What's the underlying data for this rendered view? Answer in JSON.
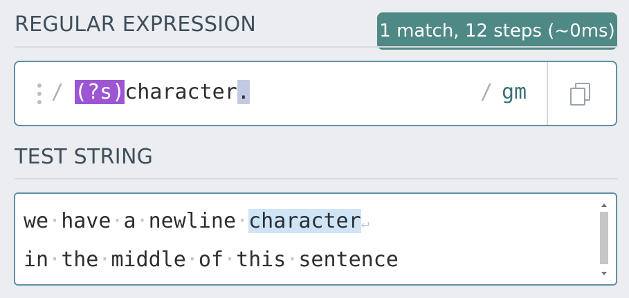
{
  "regex_section": {
    "title": "REGULAR EXPRESSION",
    "match_info": "1 match, 12 steps (~0ms)",
    "delimiter_open": "/",
    "delimiter_close": "/",
    "flags": "gm",
    "expression_tokens": [
      {
        "text": "(?s)",
        "kind": "inline-modifier-group"
      },
      {
        "text": "character",
        "kind": "literal"
      },
      {
        "text": ".",
        "kind": "any-char"
      }
    ],
    "copy_icon": "copy-icon",
    "drag_icon": "drag-handle-icon"
  },
  "test_section": {
    "title": "TEST STRING",
    "line1_words": [
      "we",
      "have",
      "a",
      "newline"
    ],
    "line1_match": "character",
    "newline_glyph": "↵",
    "line2_words": [
      "in",
      "the",
      "middle",
      "of",
      "this",
      "sentence"
    ],
    "whitespace_glyph": "·"
  },
  "colors": {
    "badge_bg": "#4e8985",
    "group_token_bg": "#9c55d3",
    "dot_token_bg": "#c3c9e3",
    "match_highlight": "#cfe4f6",
    "box_border": "#5e8fa8"
  }
}
